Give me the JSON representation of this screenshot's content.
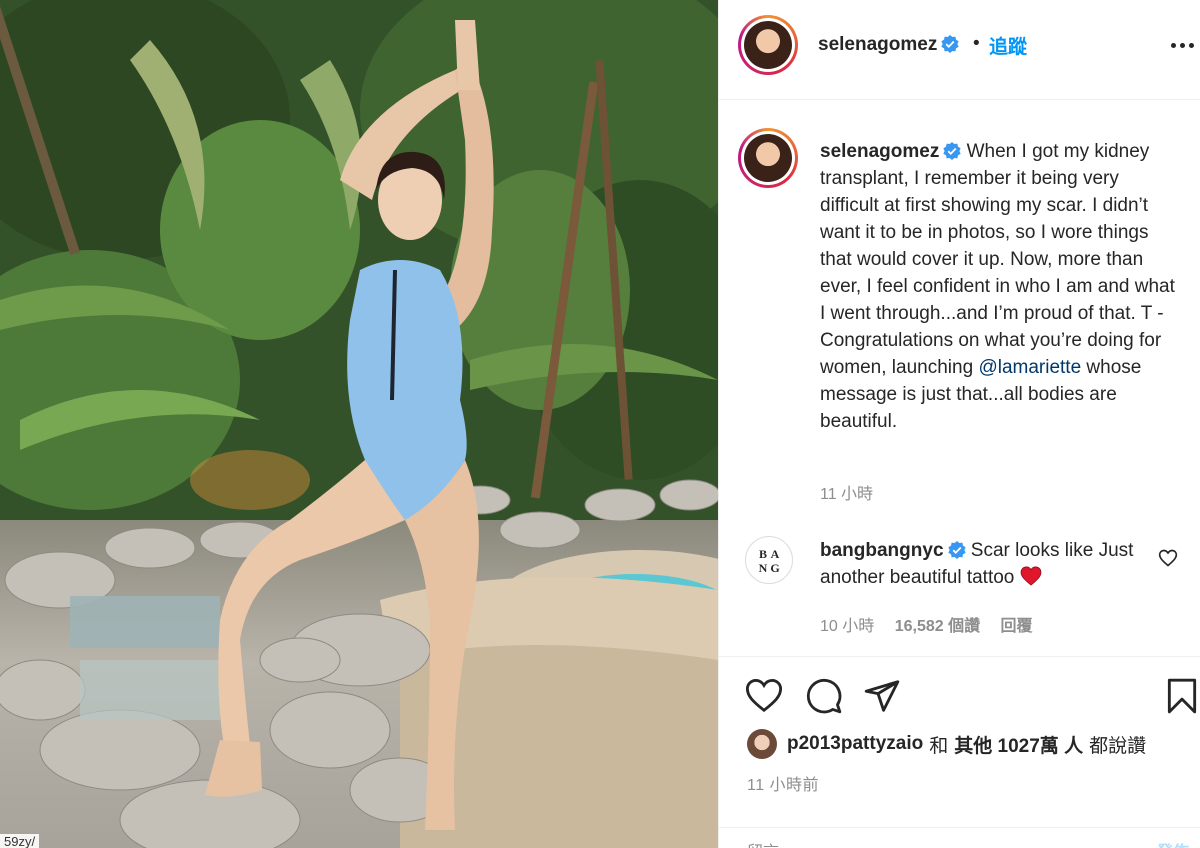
{
  "photo": {
    "alt_hint": "",
    "corner_text": "59zy/"
  },
  "header": {
    "username": "selenagomez",
    "separator": "•",
    "follow_label": "追蹤"
  },
  "caption": {
    "username": "selenagomez",
    "text_before_mention": "When I got my kidney transplant, I remember it being very difficult at first showing my scar. I didn’t want it to be in photos, so I wore things that would cover it up. Now, more than ever, I feel confident in who I am and what I went through...and I’m proud of that. T - Congratulations on what you’re doing for women, launching ",
    "mention": "@lamariette",
    "text_after_mention": " whose message is just that...all bodies are beautiful.",
    "time": "11 小時"
  },
  "comment": {
    "logo_letters": [
      "B",
      "A",
      "N",
      "G"
    ],
    "username": "bangbangnyc",
    "text": "Scar looks like Just another beautiful tattoo",
    "time": "10 小時",
    "likes": "16,582 個讚",
    "reply_label": "回覆"
  },
  "actions": {
    "liked_by_user": "p2013pattyzaio",
    "liked_by_join": "和",
    "liked_by_others": "其他 1027萬 人",
    "liked_by_suffix": "都說讚",
    "post_time": "11 小時前"
  },
  "comment_box": {
    "placeholder": "留言……",
    "post_label": "發佈"
  },
  "colors": {
    "accent": "#0095f6",
    "mention": "#00376b",
    "muted": "#8e8e8e",
    "heart": "#ed4956"
  }
}
